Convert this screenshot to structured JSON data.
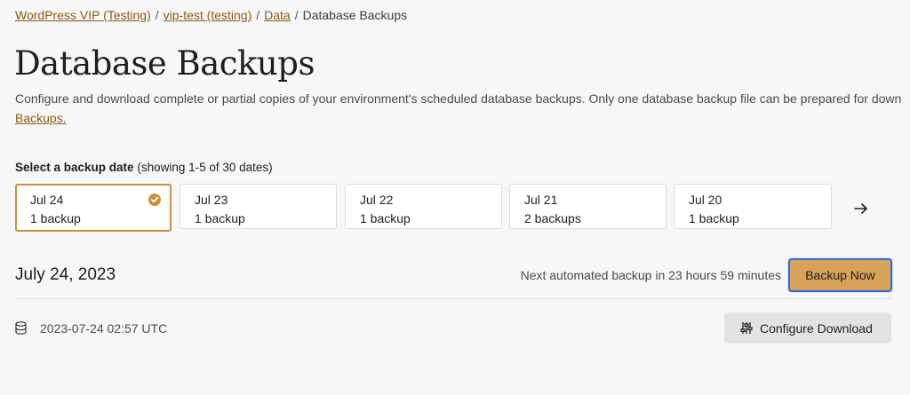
{
  "breadcrumb": {
    "items": [
      "WordPress VIP (Testing)",
      "vip-test (testing)",
      "Data"
    ],
    "current": "Database Backups",
    "separator": "/"
  },
  "page": {
    "title": "Database Backups",
    "description_line1": "Configure and download complete or partial copies of your environment's scheduled database backups. Only one database backup file can be prepared for down",
    "description_link": "Backups."
  },
  "selector": {
    "label": "Select a backup date",
    "showing": "(showing 1-5 of 30 dates)",
    "dates": [
      {
        "date": "Jul 24",
        "count": "1 backup",
        "selected": true
      },
      {
        "date": "Jul 23",
        "count": "1 backup",
        "selected": false
      },
      {
        "date": "Jul 22",
        "count": "1 backup",
        "selected": false
      },
      {
        "date": "Jul 21",
        "count": "2 backups",
        "selected": false
      },
      {
        "date": "Jul 20",
        "count": "1 backup",
        "selected": false
      }
    ],
    "next_icon": "arrow-right-icon"
  },
  "section": {
    "date": "July 24, 2023",
    "next_backup_text": "Next automated backup in 23 hours 59 minutes",
    "backup_now_label": "Backup Now"
  },
  "backups": [
    {
      "timestamp": "2023-07-24 02:57 UTC",
      "icon": "database-icon",
      "action_label": "Configure Download",
      "action_icon": "sliders-icon"
    }
  ],
  "colors": {
    "accent": "#c6923b",
    "link": "#8a5a14",
    "primary_button": "#d9a25a",
    "focus_ring": "#2f6cd9"
  }
}
